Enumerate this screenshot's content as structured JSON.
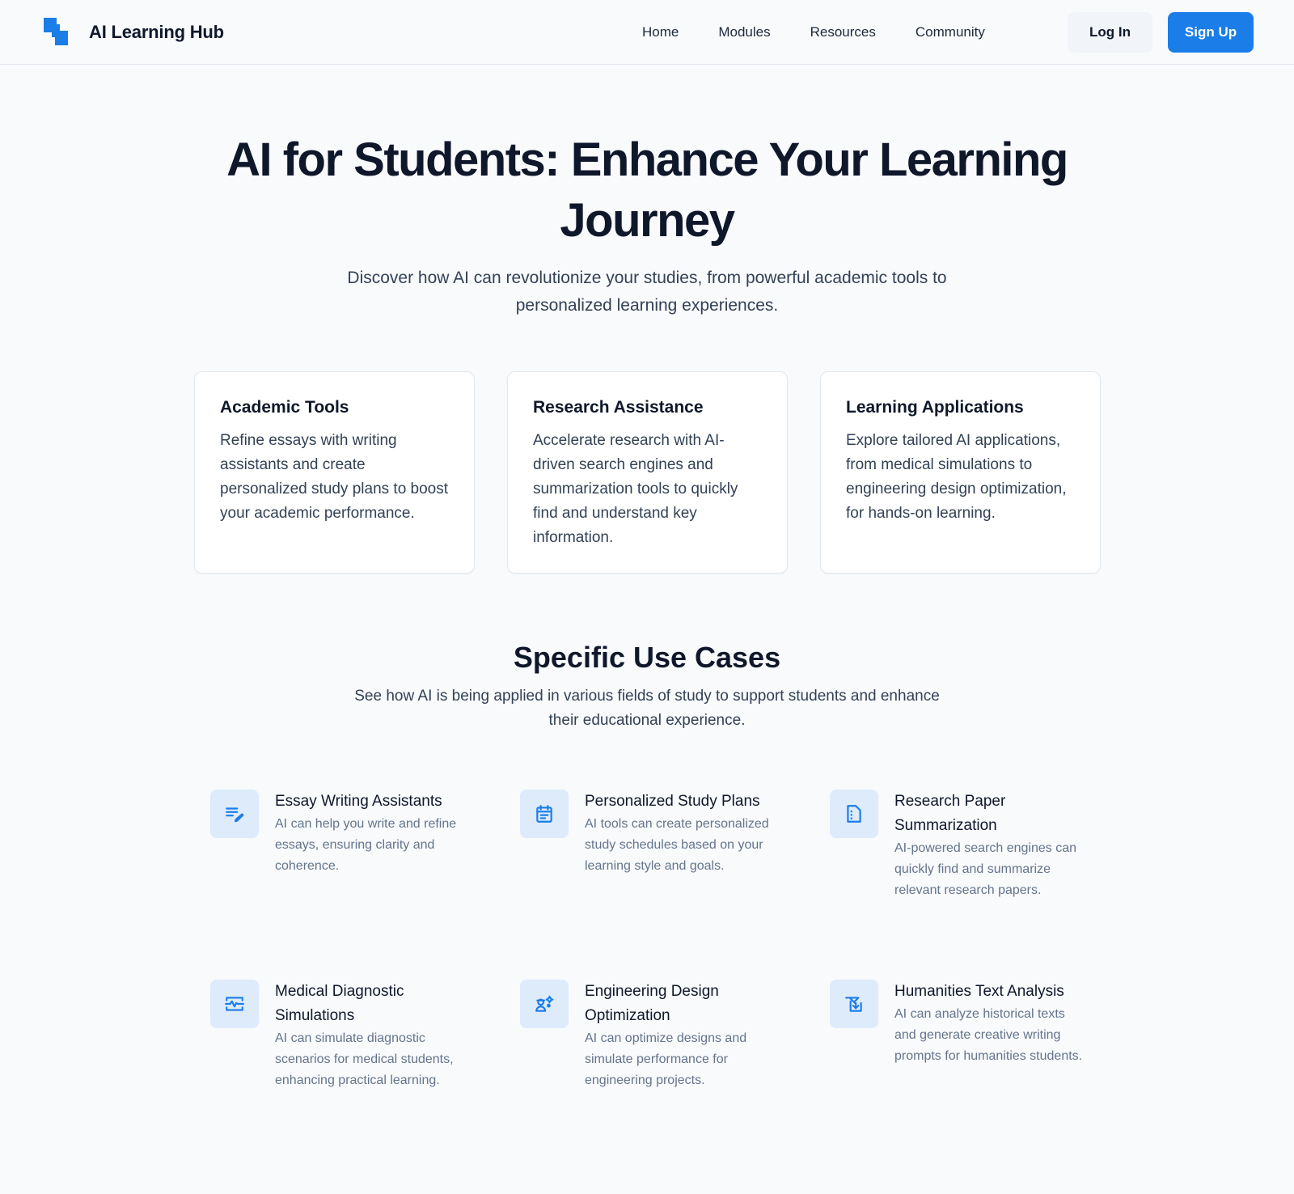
{
  "header": {
    "brand_name": "AI Learning Hub",
    "nav": [
      "Home",
      "Modules",
      "Resources",
      "Community"
    ],
    "login_label": "Log In",
    "signup_label": "Sign Up"
  },
  "hero": {
    "title": "AI for Students: Enhance Your Learning Journey",
    "subtitle": "Discover how AI can revolutionize your studies, from powerful academic tools to personalized learning experiences."
  },
  "cards": [
    {
      "title": "Academic Tools",
      "text": "Refine essays with writing assistants and create personalized study plans to boost your academic performance."
    },
    {
      "title": "Research Assistance",
      "text": "Accelerate research with AI-driven search engines and summarization tools to quickly find and understand key information."
    },
    {
      "title": "Learning Applications",
      "text": "Explore tailored AI applications, from medical simulations to engineering design optimization, for hands-on learning."
    }
  ],
  "use_cases": {
    "title": "Specific Use Cases",
    "subtitle": "See how AI is being applied in various fields of study to support students and enhance their educational experience.",
    "items": [
      {
        "icon": "edit-note-icon",
        "title": "Essay Writing Assistants",
        "text": "AI can help you write and refine essays, ensuring clarity and coherence."
      },
      {
        "icon": "calendar-icon",
        "title": "Personalized Study Plans",
        "text": "AI tools can create personalized study schedules based on your learning style and goals."
      },
      {
        "icon": "document-icon",
        "title": "Research Paper Summarization",
        "text": "AI-powered search engines can quickly find and summarize relevant research papers."
      },
      {
        "icon": "monitor-heart-icon",
        "title": "Medical Diagnostic Simulations",
        "text": "AI can simulate diagnostic scenarios for medical students, enhancing practical learning."
      },
      {
        "icon": "engineering-icon",
        "title": "Engineering Design Optimization",
        "text": "AI can optimize designs and simulate performance for engineering projects."
      },
      {
        "icon": "history-edu-icon",
        "title": "Humanities Text Analysis",
        "text": "AI can analyze historical texts and generate creative writing prompts for humanities students."
      }
    ]
  },
  "colors": {
    "accent": "#1a7de8",
    "background": "#f8fafc",
    "icon_tile": "#deebfb"
  }
}
